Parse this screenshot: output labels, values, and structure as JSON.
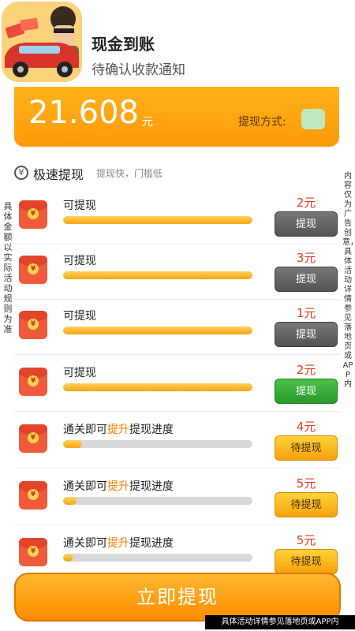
{
  "header": {
    "title": "现金到账",
    "subtitle": "待确认收款通知",
    "icon": "app-icon-car-character"
  },
  "balance": {
    "amount": "21.608",
    "unit": "元",
    "method_label": "提现方式:",
    "method_icon": "wechat-icon"
  },
  "section": {
    "icon_glyph": "¥",
    "title": "极速提现",
    "subtitle": "提现快，门槛低"
  },
  "side_left": "具体金额以实际活动规则为准",
  "side_right": "内容仅为广告创意，具体活动详情参见落地页或APP内",
  "rows": [
    {
      "label": "可提现",
      "label_hl": "",
      "label_tail": "",
      "progress": 1.0,
      "amount": "2元",
      "button": "提现",
      "button_style": "gray"
    },
    {
      "label": "可提现",
      "label_hl": "",
      "label_tail": "",
      "progress": 1.0,
      "amount": "3元",
      "button": "提现",
      "button_style": "gray"
    },
    {
      "label": "可提现",
      "label_hl": "",
      "label_tail": "",
      "progress": 1.0,
      "amount": "1元",
      "button": "提现",
      "button_style": "gray"
    },
    {
      "label": "可提现",
      "label_hl": "",
      "label_tail": "",
      "progress": 1.0,
      "amount": "2元",
      "button": "提现",
      "button_style": "green"
    },
    {
      "label": "通关即可",
      "label_hl": "提升",
      "label_tail": "提现进度",
      "progress": 0.1,
      "amount": "4元",
      "button": "待提现",
      "button_style": "orange"
    },
    {
      "label": "通关即可",
      "label_hl": "提升",
      "label_tail": "提现进度",
      "progress": 0.07,
      "amount": "5元",
      "button": "待提现",
      "button_style": "orange"
    },
    {
      "label": "通关即可",
      "label_hl": "提升",
      "label_tail": "提现进度",
      "progress": 0.05,
      "amount": "5元",
      "button": "待提现",
      "button_style": "orange"
    }
  ],
  "cta": {
    "label": "立即提现"
  },
  "footer_note": "具体活动详情参见落地页或APP内",
  "colors": {
    "accent": "#ff9a0a",
    "amount_red": "#e53a1e",
    "green": "#279a2b"
  }
}
